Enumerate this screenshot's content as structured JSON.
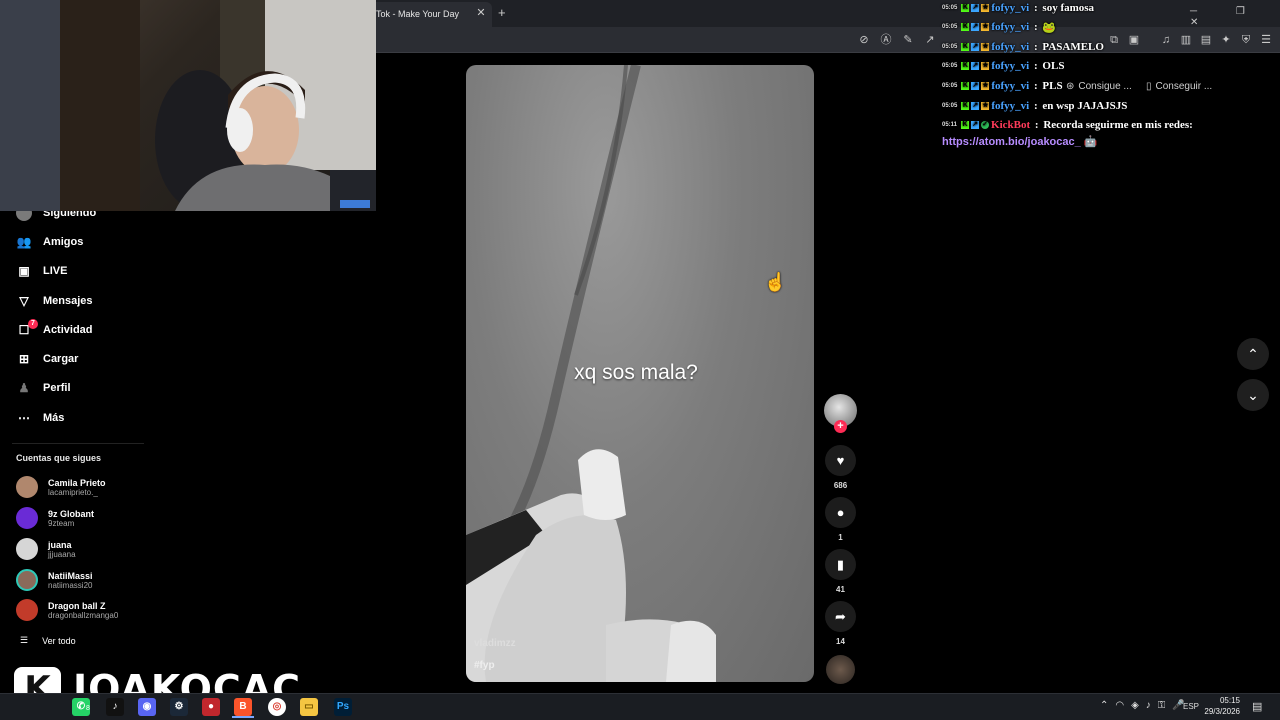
{
  "browser": {
    "tab_title": "Tok - Make Your Day",
    "tab_close": "✕",
    "new_tab": "+",
    "window_controls": "─ ❐ ✕"
  },
  "sidebar": {
    "nav": [
      {
        "label": "Siguiendo",
        "icon": "following-icon"
      },
      {
        "label": "Amigos",
        "icon": "friends-icon"
      },
      {
        "label": "LIVE",
        "icon": "live-icon"
      },
      {
        "label": "Mensajes",
        "icon": "messages-icon"
      },
      {
        "label": "Actividad",
        "icon": "activity-icon"
      },
      {
        "label": "Cargar",
        "icon": "upload-icon"
      },
      {
        "label": "Perfil",
        "icon": "profile-icon"
      },
      {
        "label": "Más",
        "icon": "more-icon"
      }
    ],
    "activity_badge": "7",
    "following_title": "Cuentas que sigues",
    "accounts": [
      {
        "name": "Camila Prieto",
        "handle": "lacamiprieto._",
        "color": "#b0876d"
      },
      {
        "name": "9z Globant",
        "handle": "9zteam",
        "color": "#6a2bd6"
      },
      {
        "name": "juana",
        "handle": "jjjuaana",
        "color": "#d6d6d6"
      },
      {
        "name": "NatiiMassi",
        "handle": "natiimassi20",
        "color": "#8a6a5a"
      },
      {
        "name": "Dragon ball Z",
        "handle": "dragonballzmanga0",
        "color": "#c23b2a"
      }
    ],
    "see_all": "Ver todo"
  },
  "video": {
    "caption": "xq sos mala?",
    "author": "vladimzz",
    "hashtag": "#fyp"
  },
  "actions": {
    "likes": "686",
    "comments": "1",
    "saves": "41",
    "shares": "14"
  },
  "chat": [
    {
      "time": "05:05",
      "user": "fofyy_vi",
      "msg": "soy famosa",
      "badges": [
        "K",
        "↗",
        "★"
      ]
    },
    {
      "time": "05:05",
      "user": "fofyy_vi",
      "msg": "🐸",
      "badges": [
        "K",
        "↗",
        "★"
      ]
    },
    {
      "time": "05:05",
      "user": "fofyy_vi",
      "msg": "PASAMELO",
      "badges": [
        "K",
        "↗",
        "★"
      ]
    },
    {
      "time": "05:05",
      "user": "fofyy_vi",
      "msg": "OLS",
      "badges": [
        "K",
        "↗",
        "★"
      ]
    },
    {
      "time": "05:05",
      "user": "fofyy_vi",
      "msg": "PLS",
      "badges": [
        "K",
        "↗",
        "★"
      ]
    },
    {
      "time": "05:05",
      "user": "fofyy_vi",
      "msg": "en wsp JAJAJSJS",
      "badges": [
        "K",
        "↗",
        "★"
      ]
    },
    {
      "time": "05:11",
      "user": "KickBot",
      "msg": "Recorda seguirme en mis redes:",
      "badges": [
        "K",
        "↗",
        "✓"
      ],
      "bot": true
    }
  ],
  "chat_link": "https://atom.bio/joakocac_ 🤖",
  "chips": [
    "Consigue ...",
    "Conseguir ..."
  ],
  "brand": {
    "letter": "K",
    "name": "JOAKOCAC"
  },
  "taskbar": {
    "lang": "ESP",
    "time": "05:15",
    "date": "29/3/2026",
    "whatsapp_badge": "8"
  },
  "colors": {
    "accent": "#fe2c55",
    "link": "#b78cff",
    "user": "#4aa3ff",
    "bot": "#ff3b5a"
  }
}
